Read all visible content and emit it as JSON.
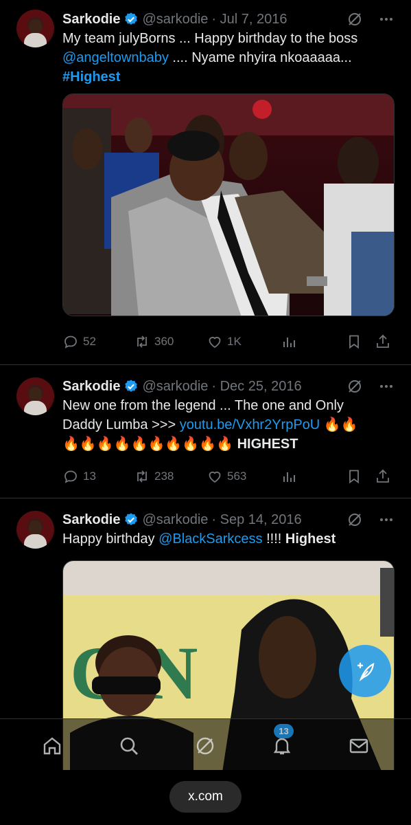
{
  "tweets": [
    {
      "name": "Sarkodie",
      "handle": "@sarkodie",
      "date": "· Jul 7, 2016",
      "text": {
        "line1": "My team julyBorns ... Happy birthday to the boss",
        "mention": "@angeltownbaby",
        "after_mention": " .... Nyame nhyira nkoaaaaa...",
        "hashtag": "#Highest"
      },
      "stats": {
        "replies": "52",
        "reposts": "360",
        "likes": "1K"
      }
    },
    {
      "name": "Sarkodie",
      "handle": "@sarkodie",
      "date": "· Dec 25, 2016",
      "text": {
        "line1": "New one from the legend ... The one and Only",
        "line2_prefix": "Daddy Lumba >>> ",
        "link": "youtu.be/Vxhr2YrpPoU",
        "emoji_tail": " 🔥🔥",
        "emoji_line": "🔥🔥🔥🔥🔥🔥🔥🔥🔥🔥",
        "tail_bold": " HIGHEST"
      },
      "stats": {
        "replies": "13",
        "reposts": "238",
        "likes": "563"
      }
    },
    {
      "name": "Sarkodie",
      "handle": "@sarkodie",
      "date": "· Sep 14, 2016",
      "text": {
        "prefix": "Happy birthday ",
        "mention": "@BlackSarkcess",
        "suffix": " !!!! ",
        "bold": "Highest"
      },
      "sign_letters": "C.N"
    }
  ],
  "nav": {
    "notifications_badge": "13",
    "items": [
      "home-icon",
      "search-icon",
      "grok-icon",
      "notifications-icon",
      "messages-icon"
    ]
  },
  "browser": {
    "url": "x.com"
  },
  "colors": {
    "accent": "#1d9bf0",
    "muted": "#71767b",
    "text": "#e7e9ea",
    "background": "#000000"
  }
}
